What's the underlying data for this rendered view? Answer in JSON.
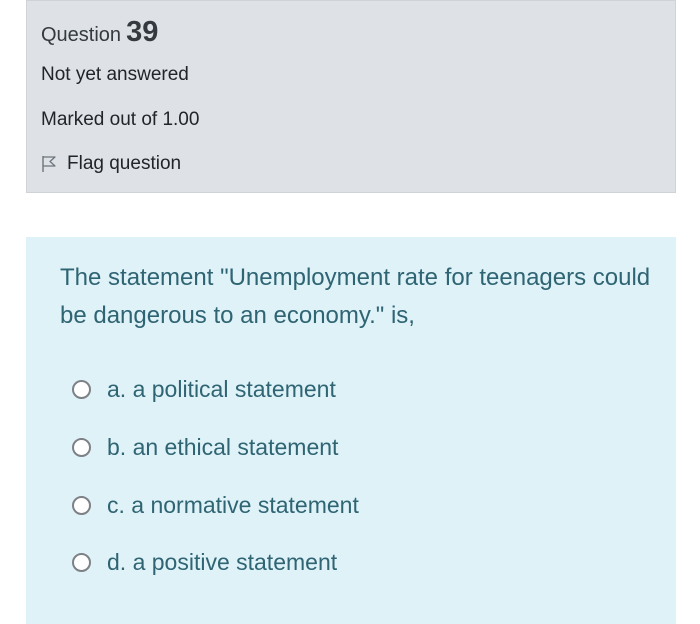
{
  "info": {
    "question_word": "Question",
    "question_number": "39",
    "state": "Not yet answered",
    "marks": "Marked out of 1.00",
    "flag_label": "Flag question"
  },
  "question": {
    "text": "The statement \"Unemployment rate for teenagers could be dangerous to an economy.\" is,",
    "answers": [
      {
        "label": "a. a political statement"
      },
      {
        "label": "b. an ethical statement"
      },
      {
        "label": "c. a normative statement"
      },
      {
        "label": "d. a positive statement"
      }
    ]
  }
}
